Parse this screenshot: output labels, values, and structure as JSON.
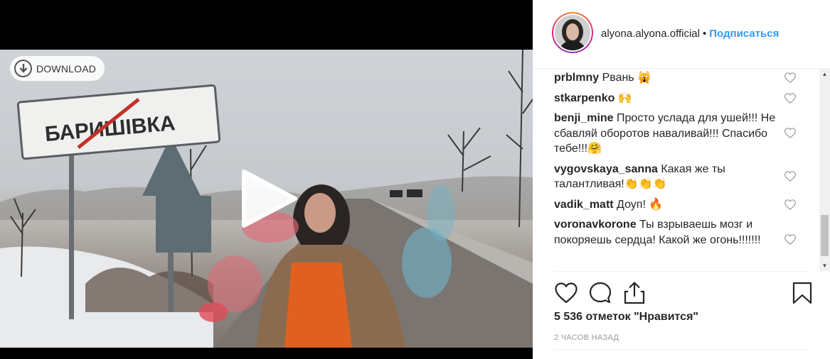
{
  "media": {
    "download_label": "DOWNLOAD",
    "sign_text": "БАРИШІВКА",
    "play_icon": "play-icon",
    "download_icon": "download-circle-icon"
  },
  "header": {
    "username": "alyona.alyona.official",
    "separator": "•",
    "follow_label": "Подписаться"
  },
  "comments": [
    {
      "user": "prblmny",
      "text": "Рвань 🙀"
    },
    {
      "user": "stkarpenko",
      "text": "🙌"
    },
    {
      "user": "benji_mine",
      "text": "Просто услада для ушей!!! Не сбавляй оборотов навaливай!!! Спасибо тебе!!!🤗"
    },
    {
      "user": "vygovskaya_sanna",
      "text": "Какая же ты талантливая!👏👏👏"
    },
    {
      "user": "vadik_matt",
      "text": "Доуп! 🔥"
    },
    {
      "user": "voronavkorone",
      "text": "Ты взрываешь мозг и покоряешь сердца! Какой же огонь!!!!!!!"
    }
  ],
  "actions": {
    "like_icon": "heart-icon",
    "comment_icon": "comment-bubble-icon",
    "share_icon": "share-icon",
    "save_icon": "bookmark-icon"
  },
  "likes_text": "5 536 отметок \"Нравится\"",
  "time_text": "2 ЧАСОВ НАЗАД",
  "colors": {
    "accent": "#3897f0",
    "text": "#262626",
    "muted": "#999999"
  }
}
